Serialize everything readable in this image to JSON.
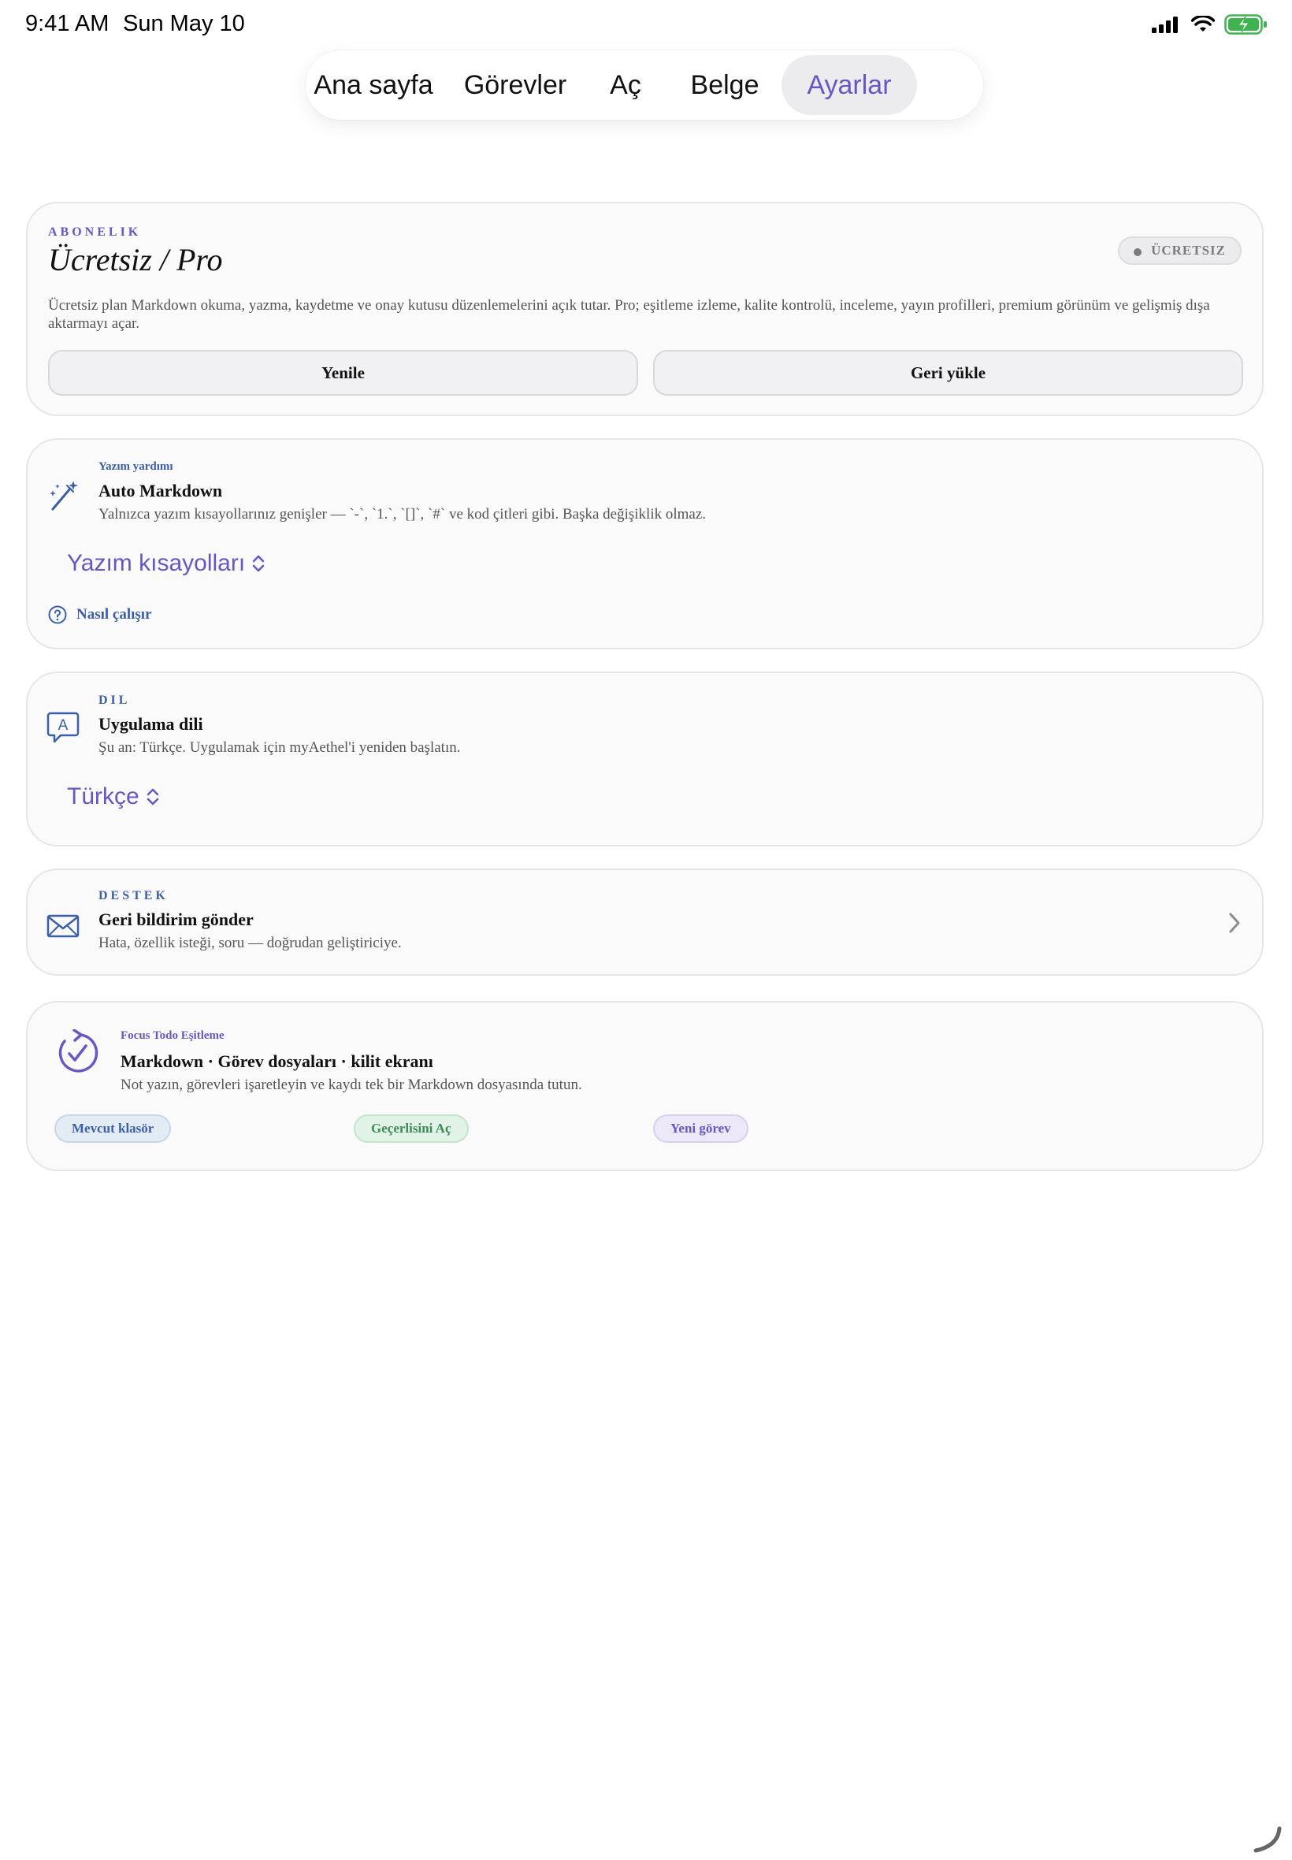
{
  "status_bar": {
    "time": "9:41 AM",
    "date": "Sun May 10",
    "icons": [
      "cellular-signal-icon",
      "wifi-icon",
      "battery-charging-icon"
    ]
  },
  "tabs": [
    {
      "label": "Ana sayfa",
      "active": false
    },
    {
      "label": "Görevler",
      "active": false
    },
    {
      "label": "Aç",
      "active": false
    },
    {
      "label": "Belge",
      "active": false
    },
    {
      "label": "Ayarlar",
      "active": true
    }
  ],
  "subscription": {
    "eyebrow": "ABONELIK",
    "title": "Ücretsiz / Pro",
    "badge": "ÜCRETSIZ",
    "description": "Ücretsiz plan Markdown okuma, yazma, kaydetme ve onay kutusu düzenlemelerini açık tutar. Pro; eşitleme izleme, kalite kontrolü, inceleme, yayın profilleri, premium görünüm ve gelişmiş dışa aktarmayı açar.",
    "refresh_button": "Yenile",
    "restore_button": "Geri yükle"
  },
  "writing_assist": {
    "eyebrow": "Yazım yardımı",
    "title": "Auto Markdown",
    "description": "Yalnızca yazım kısayollarınız genişler — `-`, `1.`, `[]`, `#` ve kod çitleri gibi. Başka değişiklik olmaz.",
    "picker_value": "Yazım kısayolları",
    "help_link": "Nasıl çalışır",
    "icon": "magic-wand-icon"
  },
  "language": {
    "eyebrow": "DIL",
    "title": "Uygulama dili",
    "description": "Şu an: Türkçe. Uygulamak için myAethel'i yeniden başlatın.",
    "picker_value": "Türkçe",
    "icon": "language-bubble-icon"
  },
  "support": {
    "eyebrow": "DESTEK",
    "title": "Geri bildirim gönder",
    "description": "Hata, özellik isteği, soru — doğrudan geliştiriciye.",
    "icon": "envelope-icon"
  },
  "sync": {
    "eyebrow": "Focus Todo Eşitleme",
    "title": "Markdown · Görev dosyaları · kilit ekranı",
    "description": "Not yazın, görevleri işaretleyin ve kaydı tek bir Markdown dosyasında tutun.",
    "chips": [
      "Mevcut klasör",
      "Geçerlisini Aç",
      "Yeni görev"
    ],
    "icon": "sync-check-icon"
  },
  "colors": {
    "accent": "#6a55c2",
    "blue": "#3a5fa8",
    "card_bg": "#fafafa",
    "border": "#e6e6e8"
  }
}
